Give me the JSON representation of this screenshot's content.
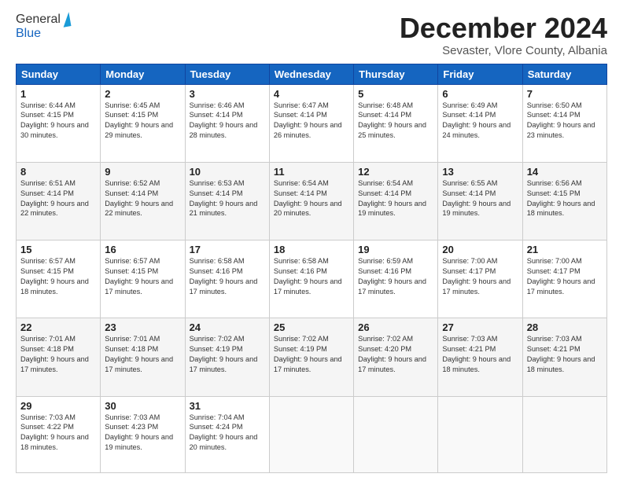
{
  "logo": {
    "line1": "General",
    "line2": "Blue"
  },
  "title": "December 2024",
  "location": "Sevaster, Vlore County, Albania",
  "days_header": [
    "Sunday",
    "Monday",
    "Tuesday",
    "Wednesday",
    "Thursday",
    "Friday",
    "Saturday"
  ],
  "weeks": [
    [
      {
        "day": "1",
        "sunrise": "6:44 AM",
        "sunset": "4:15 PM",
        "daylight": "9 hours and 30 minutes."
      },
      {
        "day": "2",
        "sunrise": "6:45 AM",
        "sunset": "4:15 PM",
        "daylight": "9 hours and 29 minutes."
      },
      {
        "day": "3",
        "sunrise": "6:46 AM",
        "sunset": "4:14 PM",
        "daylight": "9 hours and 28 minutes."
      },
      {
        "day": "4",
        "sunrise": "6:47 AM",
        "sunset": "4:14 PM",
        "daylight": "9 hours and 26 minutes."
      },
      {
        "day": "5",
        "sunrise": "6:48 AM",
        "sunset": "4:14 PM",
        "daylight": "9 hours and 25 minutes."
      },
      {
        "day": "6",
        "sunrise": "6:49 AM",
        "sunset": "4:14 PM",
        "daylight": "9 hours and 24 minutes."
      },
      {
        "day": "7",
        "sunrise": "6:50 AM",
        "sunset": "4:14 PM",
        "daylight": "9 hours and 23 minutes."
      }
    ],
    [
      {
        "day": "8",
        "sunrise": "6:51 AM",
        "sunset": "4:14 PM",
        "daylight": "9 hours and 22 minutes."
      },
      {
        "day": "9",
        "sunrise": "6:52 AM",
        "sunset": "4:14 PM",
        "daylight": "9 hours and 22 minutes."
      },
      {
        "day": "10",
        "sunrise": "6:53 AM",
        "sunset": "4:14 PM",
        "daylight": "9 hours and 21 minutes."
      },
      {
        "day": "11",
        "sunrise": "6:54 AM",
        "sunset": "4:14 PM",
        "daylight": "9 hours and 20 minutes."
      },
      {
        "day": "12",
        "sunrise": "6:54 AM",
        "sunset": "4:14 PM",
        "daylight": "9 hours and 19 minutes."
      },
      {
        "day": "13",
        "sunrise": "6:55 AM",
        "sunset": "4:14 PM",
        "daylight": "9 hours and 19 minutes."
      },
      {
        "day": "14",
        "sunrise": "6:56 AM",
        "sunset": "4:15 PM",
        "daylight": "9 hours and 18 minutes."
      }
    ],
    [
      {
        "day": "15",
        "sunrise": "6:57 AM",
        "sunset": "4:15 PM",
        "daylight": "9 hours and 18 minutes."
      },
      {
        "day": "16",
        "sunrise": "6:57 AM",
        "sunset": "4:15 PM",
        "daylight": "9 hours and 17 minutes."
      },
      {
        "day": "17",
        "sunrise": "6:58 AM",
        "sunset": "4:16 PM",
        "daylight": "9 hours and 17 minutes."
      },
      {
        "day": "18",
        "sunrise": "6:58 AM",
        "sunset": "4:16 PM",
        "daylight": "9 hours and 17 minutes."
      },
      {
        "day": "19",
        "sunrise": "6:59 AM",
        "sunset": "4:16 PM",
        "daylight": "9 hours and 17 minutes."
      },
      {
        "day": "20",
        "sunrise": "7:00 AM",
        "sunset": "4:17 PM",
        "daylight": "9 hours and 17 minutes."
      },
      {
        "day": "21",
        "sunrise": "7:00 AM",
        "sunset": "4:17 PM",
        "daylight": "9 hours and 17 minutes."
      }
    ],
    [
      {
        "day": "22",
        "sunrise": "7:01 AM",
        "sunset": "4:18 PM",
        "daylight": "9 hours and 17 minutes."
      },
      {
        "day": "23",
        "sunrise": "7:01 AM",
        "sunset": "4:18 PM",
        "daylight": "9 hours and 17 minutes."
      },
      {
        "day": "24",
        "sunrise": "7:02 AM",
        "sunset": "4:19 PM",
        "daylight": "9 hours and 17 minutes."
      },
      {
        "day": "25",
        "sunrise": "7:02 AM",
        "sunset": "4:19 PM",
        "daylight": "9 hours and 17 minutes."
      },
      {
        "day": "26",
        "sunrise": "7:02 AM",
        "sunset": "4:20 PM",
        "daylight": "9 hours and 17 minutes."
      },
      {
        "day": "27",
        "sunrise": "7:03 AM",
        "sunset": "4:21 PM",
        "daylight": "9 hours and 18 minutes."
      },
      {
        "day": "28",
        "sunrise": "7:03 AM",
        "sunset": "4:21 PM",
        "daylight": "9 hours and 18 minutes."
      }
    ],
    [
      {
        "day": "29",
        "sunrise": "7:03 AM",
        "sunset": "4:22 PM",
        "daylight": "9 hours and 18 minutes."
      },
      {
        "day": "30",
        "sunrise": "7:03 AM",
        "sunset": "4:23 PM",
        "daylight": "9 hours and 19 minutes."
      },
      {
        "day": "31",
        "sunrise": "7:04 AM",
        "sunset": "4:24 PM",
        "daylight": "9 hours and 20 minutes."
      },
      null,
      null,
      null,
      null
    ]
  ]
}
